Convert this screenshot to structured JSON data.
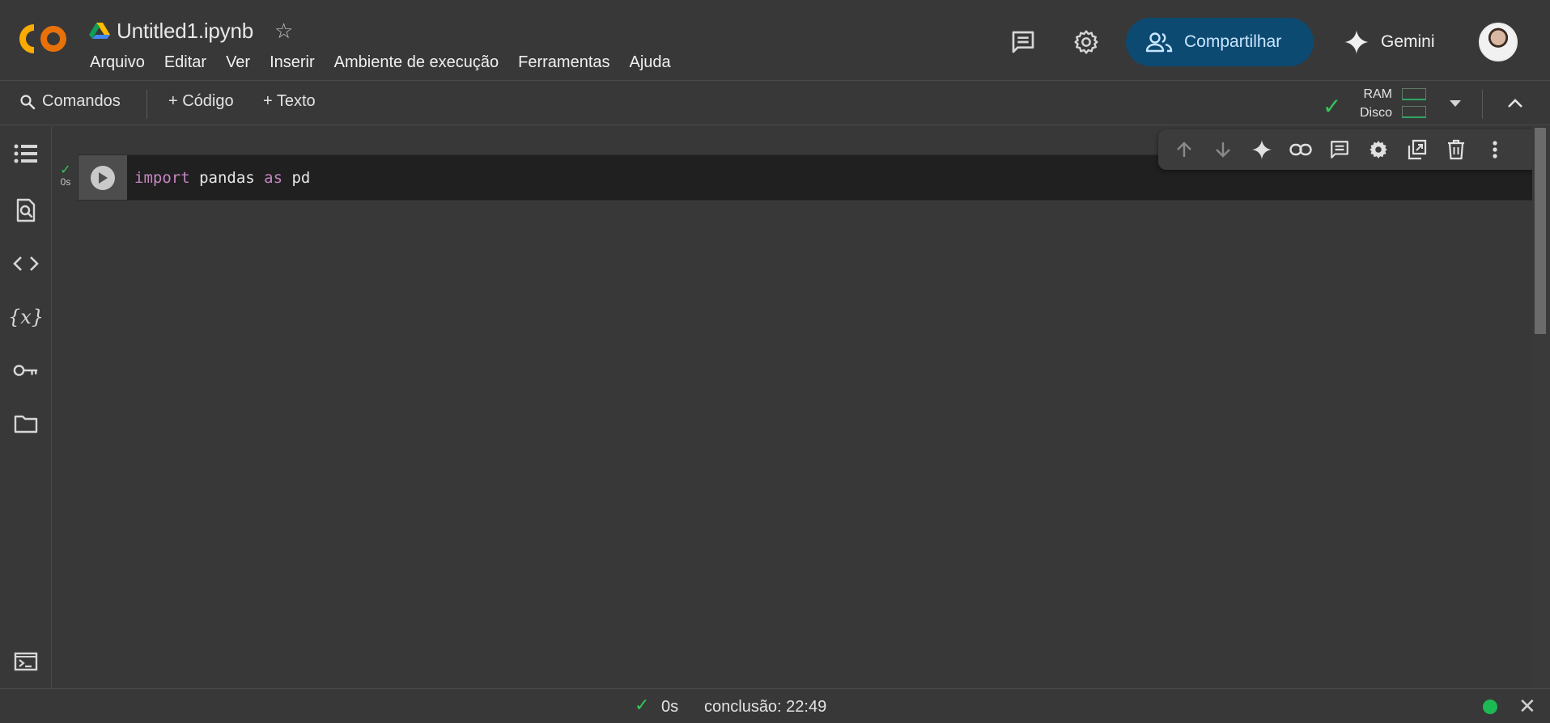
{
  "header": {
    "logo_text": "CO",
    "drive_icon": "google-drive-icon",
    "doc_title": "Untitled1.ipynb",
    "menu": [
      "Arquivo",
      "Editar",
      "Ver",
      "Inserir",
      "Ambiente de execução",
      "Ferramentas",
      "Ajuda"
    ],
    "share_label": "Compartilhar",
    "gemini_label": "Gemini"
  },
  "toolbar": {
    "commands_label": "Comandos",
    "add_code_label": "+ Código",
    "add_text_label": "+ Texto",
    "ram_label": "RAM",
    "disk_label": "Disco"
  },
  "rail_icons": [
    "table-of-contents-icon",
    "search-icon",
    "code-snippets-icon",
    "variables-icon",
    "secrets-icon",
    "files-icon",
    "terminal-icon"
  ],
  "cell": {
    "status_check": "✓",
    "exec_time": "0s",
    "code_keyword_import": "import",
    "code_module": " pandas ",
    "code_keyword_as": "as",
    "code_alias": " pd"
  },
  "statusbar": {
    "check": "✓",
    "elapsed": "0s",
    "completion": "conclusão: 22:49"
  },
  "colors": {
    "background": "#383838",
    "share_bg": "#0d4a72",
    "status_green": "#34c759",
    "keyword": "#c586c0"
  }
}
